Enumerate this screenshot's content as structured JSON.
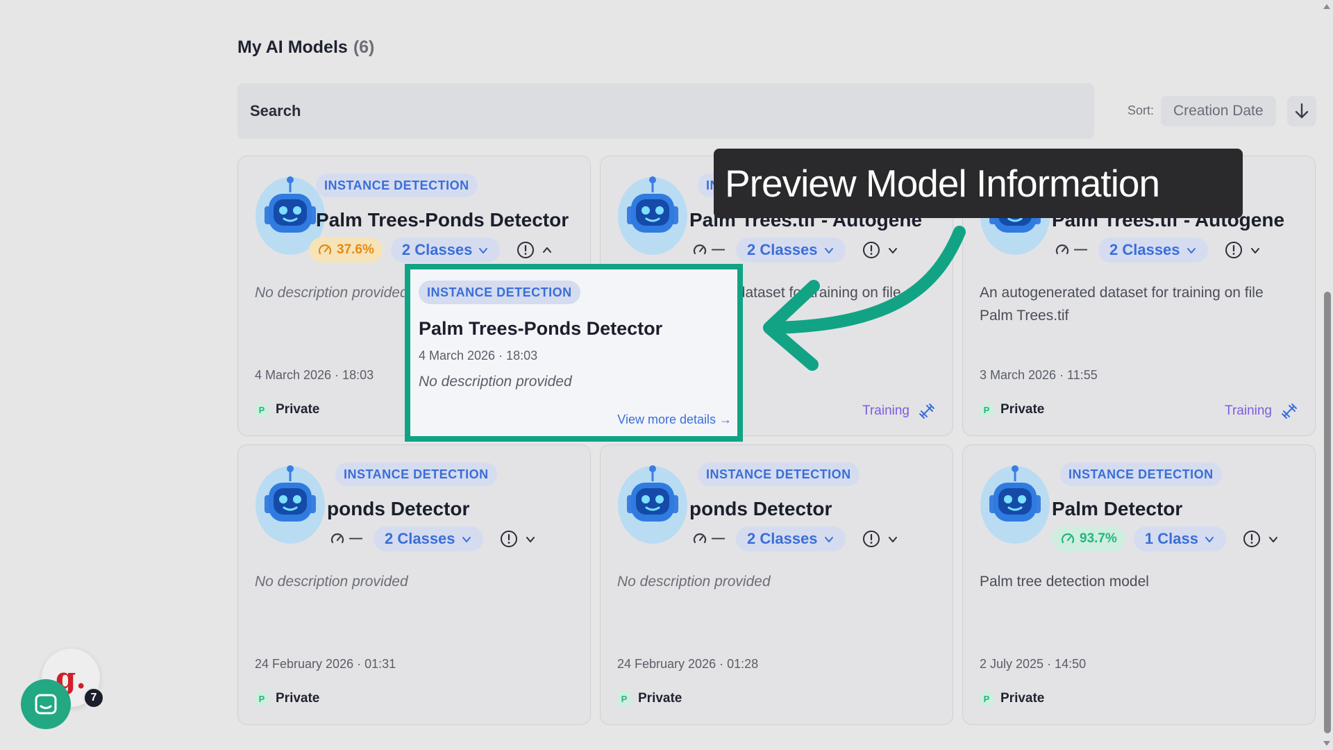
{
  "header": {
    "title": "My AI Models",
    "count": "(6)"
  },
  "search": {
    "label": "Search"
  },
  "sort": {
    "label": "Sort:",
    "value": "Creation Date"
  },
  "cards": [
    {
      "type": "INSTANCE DETECTION",
      "title": "Palm Trees-Ponds Detector",
      "accuracy": "37.6%",
      "accuracy_color": "orange",
      "classes": "2 Classes",
      "description": "No description provided",
      "desc_empty": true,
      "date": "4 March 2026 · 18:03",
      "visibility": "Private",
      "status": "",
      "expanded": true
    },
    {
      "type": "INSTANCE DETECTION",
      "title": "Palm Trees.tif - Autogene",
      "accuracy": "—",
      "accuracy_color": "none",
      "classes": "2 Classes",
      "description": "An autogenerated dataset for training on file Palm Trees.tif",
      "desc_empty": false,
      "date": "",
      "visibility": "",
      "status": "Training"
    },
    {
      "type": "INSTANCE DETECTION",
      "title": "Palm Trees.tif - Autogene",
      "accuracy": "—",
      "accuracy_color": "none",
      "classes": "2 Classes",
      "description": "An autogenerated dataset for training on file Palm Trees.tif",
      "desc_empty": false,
      "date": "3 March 2026 · 11:55",
      "visibility": "Private",
      "status": "Training"
    },
    {
      "type": "INSTANCE DETECTION",
      "title": "ponds Detector",
      "accuracy": "—",
      "accuracy_color": "none",
      "classes": "2 Classes",
      "description": "No description provided",
      "desc_empty": true,
      "date": "24 February 2026 · 01:31",
      "visibility": "Private",
      "status": ""
    },
    {
      "type": "INSTANCE DETECTION",
      "title": "ponds Detector",
      "accuracy": "—",
      "accuracy_color": "none",
      "classes": "2 Classes",
      "description": "No description provided",
      "desc_empty": true,
      "date": "24 February 2026 · 01:28",
      "visibility": "Private",
      "status": ""
    },
    {
      "type": "INSTANCE DETECTION",
      "title": "Palm Detector",
      "accuracy": "93.7%",
      "accuracy_color": "green",
      "classes": "1 Class",
      "description": "Palm tree detection model",
      "desc_empty": false,
      "date": "2 July 2025 · 14:50",
      "visibility": "Private",
      "status": ""
    }
  ],
  "popup": {
    "type": "INSTANCE DETECTION",
    "title": "Palm Trees-Ponds Detector",
    "date": "4 March 2026 · 18:03",
    "description": "No description provided",
    "link": "View more details →"
  },
  "annotation": {
    "text": "Preview Model Information",
    "color": "#12a385"
  },
  "chat": {
    "unread": "7",
    "logo_text": "g."
  },
  "visibility_initial": "P"
}
